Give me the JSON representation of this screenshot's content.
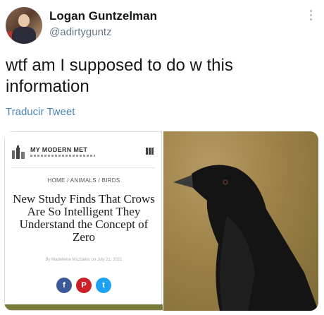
{
  "user": {
    "name": "Logan Guntzelman",
    "handle": "@adirtyguntz"
  },
  "tweet": {
    "text": "wtf am I supposed to do w this information",
    "translate_label": "Traducir Tweet"
  },
  "article": {
    "site_name": "MY MODERN MET",
    "breadcrumb": "HOME / ANIMALS / BIRDS",
    "headline": "New Study Finds That Crows Are So Intelligent They Understand the Concept of Zero",
    "byline": "By Madeleine Muzdakis on July 21, 2021",
    "share_buttons": [
      {
        "icon": "facebook-icon",
        "glyph": "f",
        "color": "#3b5998"
      },
      {
        "icon": "pinterest-icon",
        "glyph": "P",
        "color": "#cb2027"
      },
      {
        "icon": "twitter-icon",
        "glyph": "t",
        "color": "#1da1f2"
      }
    ]
  },
  "photo": {
    "subject": "crow"
  }
}
